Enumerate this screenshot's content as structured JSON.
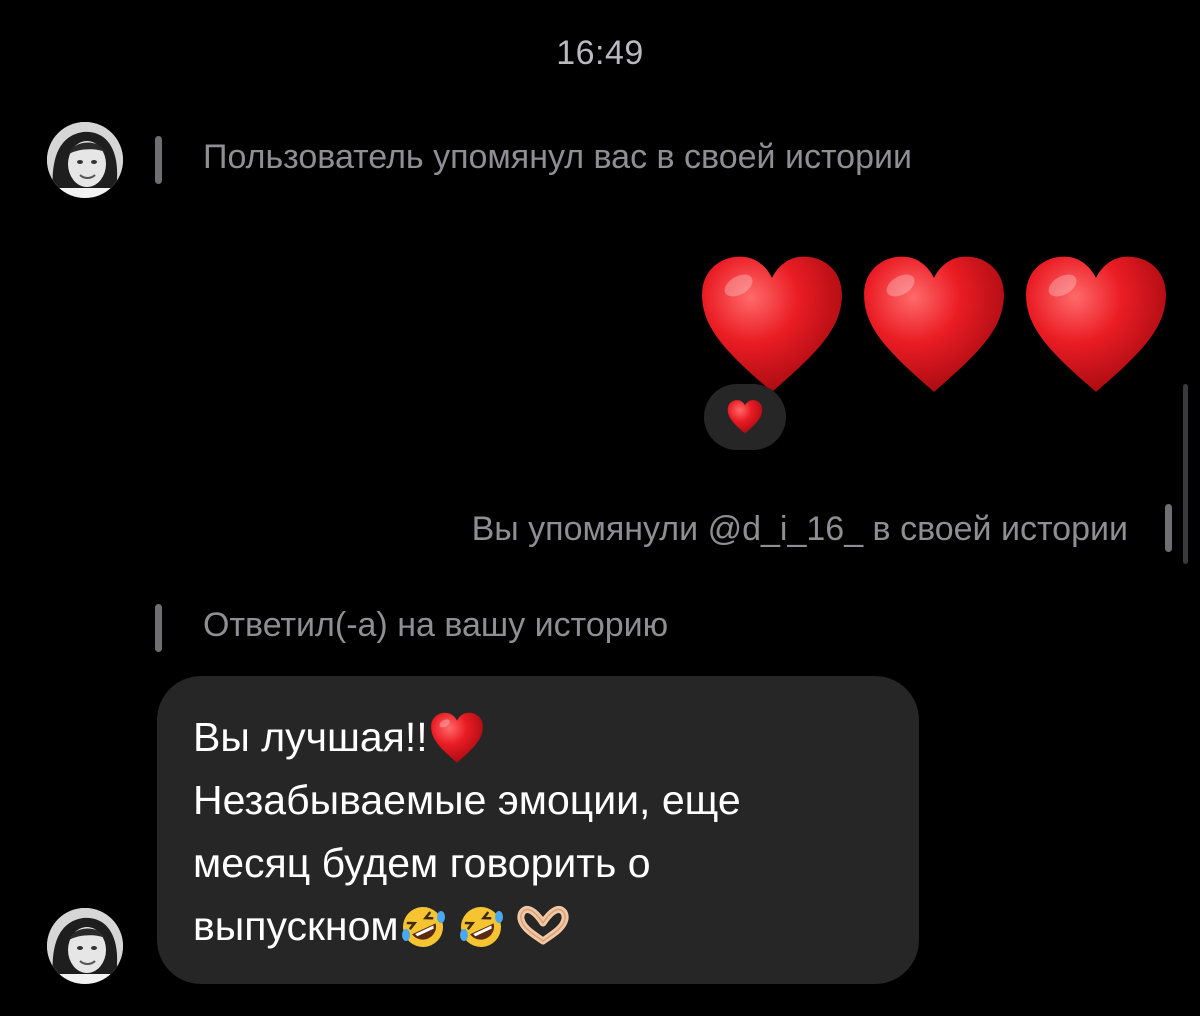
{
  "chat": {
    "timestamp": "16:49",
    "mention_notice": "Пользователь упомянул вас в своей истории",
    "reaction_emojis": [
      "red-heart",
      "red-heart",
      "red-heart"
    ],
    "reaction_pill_emoji": "red-heart",
    "you_mentioned": "Вы упомянули @d_i_16_ в своей истории",
    "replied_notice": "Ответил(-а) на вашу историю",
    "message": {
      "line1": "Вы лучшая!!",
      "line1_emoji": "red-heart",
      "line2": "Незабываемые эмоции, еще",
      "line3": "месяц будем говорить о",
      "line4": "выпускном",
      "line4_emojis": [
        "rolling-on-the-floor-laughing",
        "rolling-on-the-floor-laughing",
        "heart-hands"
      ]
    }
  },
  "colors": {
    "background": "#000000",
    "bubble": "#262626",
    "meta_text": "#8e8e93",
    "heart": "#e0141e"
  }
}
